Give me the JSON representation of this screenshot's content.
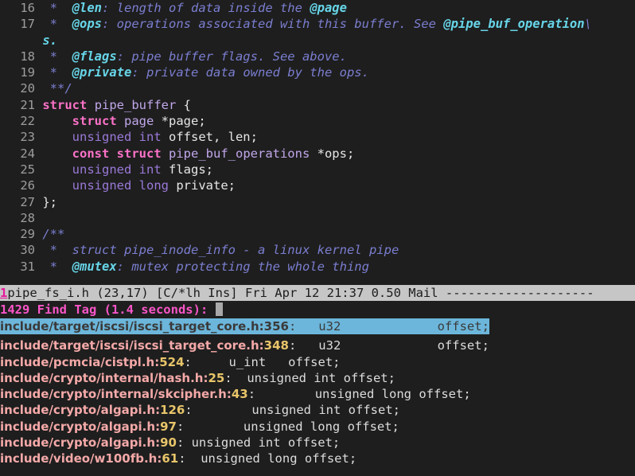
{
  "editor": {
    "lines": [
      {
        "num": "16",
        "segments": [
          {
            "t": " * ",
            "c": "c-star"
          },
          {
            "t": " @len",
            "c": "c-tag"
          },
          {
            "t": ": length of data inside the ",
            "c": "c-comment"
          },
          {
            "t": "@page",
            "c": "c-tag"
          }
        ]
      },
      {
        "num": "17",
        "segments": [
          {
            "t": " * ",
            "c": "c-star"
          },
          {
            "t": " @ops",
            "c": "c-tag"
          },
          {
            "t": ": operations associated with this buffer. See ",
            "c": "c-comment"
          },
          {
            "t": "@pipe_buf_operation",
            "c": "c-tag"
          },
          {
            "t": "\\",
            "c": "c-comment"
          }
        ]
      },
      {
        "num": "",
        "segments": [
          {
            "t": "s.",
            "c": "c-tag"
          }
        ]
      },
      {
        "num": "18",
        "segments": [
          {
            "t": " * ",
            "c": "c-star"
          },
          {
            "t": " @flags",
            "c": "c-tag"
          },
          {
            "t": ": pipe buffer flags. See above.",
            "c": "c-comment"
          }
        ]
      },
      {
        "num": "19",
        "segments": [
          {
            "t": " * ",
            "c": "c-star"
          },
          {
            "t": " @private",
            "c": "c-tag"
          },
          {
            "t": ": private data owned by the ops.",
            "c": "c-comment"
          }
        ]
      },
      {
        "num": "20",
        "segments": [
          {
            "t": " **/",
            "c": "c-comment"
          }
        ]
      },
      {
        "num": "21",
        "segments": [
          {
            "t": "struct",
            "c": "c-kw"
          },
          {
            "t": " ",
            "c": "c-plain"
          },
          {
            "t": "pipe_buffer",
            "c": "c-ident"
          },
          {
            "t": " {",
            "c": "c-plain"
          }
        ]
      },
      {
        "num": "22",
        "segments": [
          {
            "t": "    ",
            "c": "c-plain"
          },
          {
            "t": "struct",
            "c": "c-kw"
          },
          {
            "t": " ",
            "c": "c-plain"
          },
          {
            "t": "page",
            "c": "c-ident"
          },
          {
            "t": " *page;",
            "c": "c-plain"
          }
        ]
      },
      {
        "num": "23",
        "segments": [
          {
            "t": "    ",
            "c": "c-plain"
          },
          {
            "t": "unsigned int",
            "c": "c-type"
          },
          {
            "t": " offset, len;",
            "c": "c-plain"
          }
        ]
      },
      {
        "num": "24",
        "segments": [
          {
            "t": "    ",
            "c": "c-plain"
          },
          {
            "t": "const struct",
            "c": "c-kw"
          },
          {
            "t": " ",
            "c": "c-plain"
          },
          {
            "t": "pipe_buf_operations",
            "c": "c-ident"
          },
          {
            "t": " *ops;",
            "c": "c-plain"
          }
        ]
      },
      {
        "num": "25",
        "segments": [
          {
            "t": "    ",
            "c": "c-plain"
          },
          {
            "t": "unsigned int",
            "c": "c-type"
          },
          {
            "t": " flags;",
            "c": "c-plain"
          }
        ]
      },
      {
        "num": "26",
        "segments": [
          {
            "t": "    ",
            "c": "c-plain"
          },
          {
            "t": "unsigned long",
            "c": "c-type"
          },
          {
            "t": " private;",
            "c": "c-plain"
          }
        ]
      },
      {
        "num": "27",
        "segments": [
          {
            "t": "};",
            "c": "c-plain"
          }
        ]
      },
      {
        "num": "28",
        "segments": []
      },
      {
        "num": "29",
        "segments": [
          {
            "t": "/**",
            "c": "c-comment"
          }
        ]
      },
      {
        "num": "30",
        "segments": [
          {
            "t": " * ",
            "c": "c-star"
          },
          {
            "t": " struct pipe_inode_info - a linux kernel pipe",
            "c": "c-comment"
          }
        ]
      },
      {
        "num": "31",
        "segments": [
          {
            "t": " * ",
            "c": "c-star"
          },
          {
            "t": " @mutex",
            "c": "c-tag"
          },
          {
            "t": ": mutex protecting the whole thing",
            "c": "c-comment"
          }
        ]
      }
    ]
  },
  "statusline": {
    "buffer_number": "1",
    "text": "pipe_fs_i.h (23,17) [C/*lh Ins] Fri Apr 12 21:37 0.50 Mail --------------------"
  },
  "cmdline": {
    "text": "1429 Find Tag (1.4 seconds): "
  },
  "results": {
    "rows": [
      {
        "selected": true,
        "file": "include/target/iscsi/iscsi_target_core.h",
        "line": "356",
        "code": ":   u32             offset;"
      },
      {
        "selected": false,
        "file": "include/target/iscsi/iscsi_target_core.h",
        "line": "348",
        "code": ":   u32             offset;"
      },
      {
        "selected": false,
        "file": "include/pcmcia/cistpl.h",
        "line": "524",
        "code": ":     u_int   offset;"
      },
      {
        "selected": false,
        "file": "include/crypto/internal/hash.h",
        "line": "25",
        "code": ":  unsigned int offset;"
      },
      {
        "selected": false,
        "file": "include/crypto/internal/skcipher.h",
        "line": "43",
        "code": ":        unsigned long offset;"
      },
      {
        "selected": false,
        "file": "include/crypto/algapi.h",
        "line": "126",
        "code": ":        unsigned int offset;"
      },
      {
        "selected": false,
        "file": "include/crypto/algapi.h",
        "line": "97",
        "code": ":        unsigned long offset;"
      },
      {
        "selected": false,
        "file": "include/crypto/algapi.h",
        "line": "90",
        "code": ": unsigned int offset;"
      },
      {
        "selected": false,
        "file": "include/video/w100fb.h",
        "line": "61",
        "code": ":  unsigned long offset;"
      }
    ]
  },
  "colors": {
    "background": "#1e1e1e",
    "statusbar_bg": "#c6c6c6",
    "selection_bg": "#6cb6db",
    "keyword": "#fb72c8",
    "type": "#9a79d8",
    "comment": "#7b7ed0",
    "doc_tag": "#67d5e8",
    "result_file": "#f4a9a8",
    "result_linenum": "#e8c56a",
    "prompt": "#fa55c8"
  }
}
